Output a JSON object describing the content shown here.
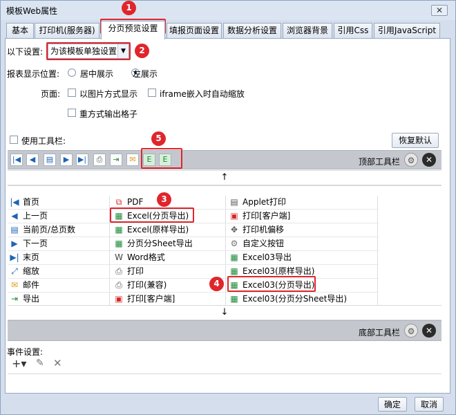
{
  "window": {
    "title": "模板Web属性",
    "close": "✕"
  },
  "tabs": [
    "基本",
    "打印机(服务器)",
    "分页预览设置",
    "填报页面设置",
    "数据分析设置",
    "浏览器背景",
    "引用Css",
    "引用JavaScript"
  ],
  "settings": {
    "label": "以下设置:",
    "select_value": "为该模板单独设置",
    "position_label": "报表显示位置:",
    "pos_center": "居中展示",
    "pos_left": "左展示",
    "page_label": "页面:",
    "opt_image": "以图片方式显示",
    "opt_iframe": "iframe嵌入时自动缩放",
    "opt_repeat": "重方式输出格子"
  },
  "toolbar": {
    "use_label": "使用工具栏:",
    "restore": "恢复默认",
    "top_label": "顶部工具栏",
    "bottom_label": "底部工具栏"
  },
  "items": {
    "col1": [
      "首页",
      "上一页",
      "当前页/总页数",
      "下一页",
      "末页",
      "缩放",
      "邮件",
      "导出"
    ],
    "col2": [
      "PDF",
      "Excel(分页导出)",
      "Excel(原样导出)",
      "分页分Sheet导出",
      "Word格式",
      "打印",
      "打印(兼容)",
      "打印[客户端]"
    ],
    "col3": [
      "Applet打印",
      "打印[客户端]",
      "打印机偏移",
      "自定义按钮",
      "Excel03导出",
      "Excel03(原样导出)",
      "Excel03(分页导出)",
      "Excel03(分页分Sheet导出)"
    ]
  },
  "events": {
    "label": "事件设置:"
  },
  "footer": {
    "ok": "确定",
    "cancel": "取消"
  },
  "badges": [
    "1",
    "2",
    "3",
    "4",
    "5"
  ],
  "colors": {
    "annotation": "#e0252b",
    "accent": "#1d64b5"
  }
}
